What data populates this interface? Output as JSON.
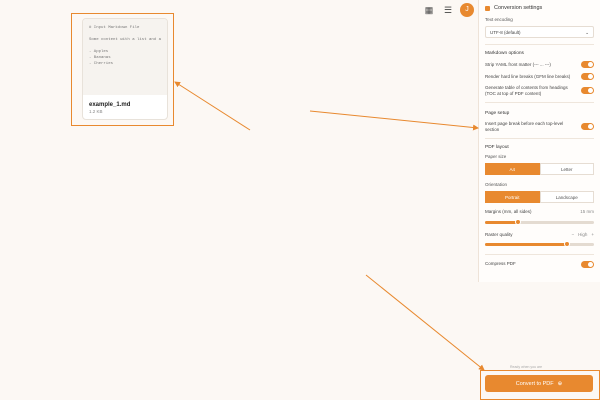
{
  "file_card": {
    "preview_lines": [
      "# Input Markdown File",
      "",
      "Some content with a list and a table",
      "",
      "- Apples",
      "- Bananas",
      "- Cherries"
    ],
    "filename": "example_1.md",
    "filesize": "1.2 KB"
  },
  "header": {
    "avatar_initial": "J"
  },
  "panel": {
    "title": "Conversion settings",
    "text_encoding_label": "Text encoding",
    "text_encoding_value": "UTF-8 (default)",
    "markdown_section": "Markdown options",
    "opt_strip": "Strip YAML front matter (--- ... ---)",
    "opt_hardbreaks": "Render hard line breaks (GFM line breaks)",
    "opt_toc": "Generate table of contents from headings (TOC at top of PDF content)",
    "page_setup_section": "Page setup",
    "opt_pagebreak": "Insert page break before each top-level section",
    "pdf_layout_section": "PDF layout",
    "paper_size_label": "Paper size",
    "paper_options": [
      "A4",
      "Letter"
    ],
    "orientation_label": "Orientation",
    "orientation_options": [
      "Portrait",
      "Landscape"
    ],
    "margins_label": "Margins (mm, all sides)",
    "margins_value": "15 mm",
    "raster_label": "Raster quality",
    "raster_value": "High",
    "compress_label": "Compress PDF"
  },
  "convert": {
    "hint": "Ready when you are",
    "label": "Convert to PDF"
  },
  "state": {
    "strip": true,
    "hardbreaks": true,
    "toc": true,
    "pagebreak": true,
    "compress": true,
    "paper_selected": "A4",
    "orientation_selected": "Portrait",
    "margins_fraction": 0.3,
    "raster_fraction": 0.75
  },
  "colors": {
    "accent": "#e8892f",
    "background": "#fcf8f4"
  }
}
